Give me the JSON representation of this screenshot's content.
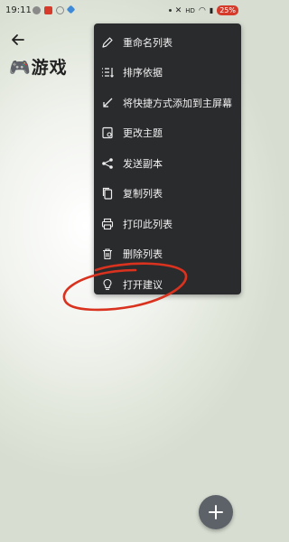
{
  "status_bar": {
    "time": "19:11",
    "battery": "25%"
  },
  "header": {
    "title": "🎮游戏"
  },
  "menu": {
    "items": [
      {
        "label": "重命名列表",
        "icon": "pencil-icon"
      },
      {
        "label": "排序依据",
        "icon": "sort-icon"
      },
      {
        "label": "将快捷方式添加到主屏幕",
        "icon": "shortcut-arrow-icon"
      },
      {
        "label": "更改主题",
        "icon": "theme-icon"
      },
      {
        "label": "发送副本",
        "icon": "share-icon"
      },
      {
        "label": "复制列表",
        "icon": "copy-icon"
      },
      {
        "label": "打印此列表",
        "icon": "printer-icon"
      },
      {
        "label": "删除列表",
        "icon": "trash-icon"
      },
      {
        "label": "打开建议",
        "icon": "lightbulb-icon"
      }
    ]
  },
  "colors": {
    "menu_bg": "#2a2b2d",
    "annotation_red": "#d9321f",
    "fab_bg": "#5c6268"
  }
}
